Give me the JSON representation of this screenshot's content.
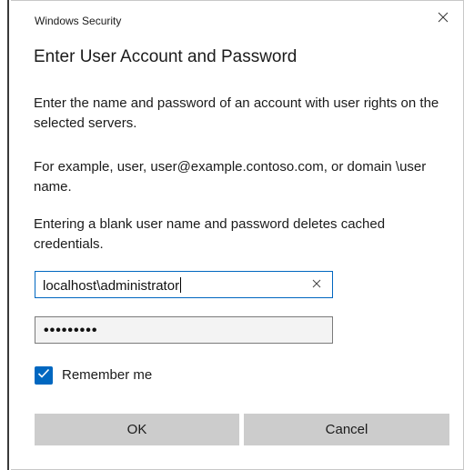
{
  "window": {
    "title": "Windows Security",
    "close_icon": "close-icon"
  },
  "dialog": {
    "heading": "Enter User Account and Password",
    "paragraphs": [
      "Enter the name and password of an account with user rights on the selected servers.",
      "For example, user, user@example.contoso.com, or domain \\user name.",
      "Entering a blank user name and password deletes cached credentials."
    ]
  },
  "form": {
    "username_value": "localhost\\administrator",
    "password_mask": "•••••••••",
    "remember_label": "Remember me",
    "remember_checked": true
  },
  "buttons": {
    "ok_label": "OK",
    "cancel_label": "Cancel"
  },
  "colors": {
    "accent": "#0067c0",
    "button_bg": "#cccccc"
  }
}
